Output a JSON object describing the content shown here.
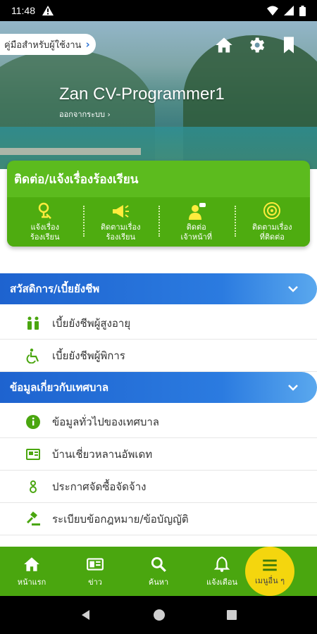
{
  "status_bar": {
    "time": "11:48",
    "warning_icon": "warning-icon",
    "wifi_icon": "wifi-icon",
    "signal_icon": "signal-icon",
    "battery_icon": "battery-icon"
  },
  "header": {
    "guide_label": "คู่มือสำหรับผู้ใช้งาน",
    "home_icon": "home-icon",
    "settings_icon": "gear-icon",
    "bookmark_icon": "bookmark-icon",
    "user_name": "Zan CV-Programmer1",
    "logout_label": "ออกจากระบบ"
  },
  "contact": {
    "title": "ติดต่อ/แจ้งเรื่องร้องเรียน",
    "items": [
      {
        "line1": "แจ้งเรื่อง",
        "line2": "ร้องเรียน",
        "icon": "complaint-icon"
      },
      {
        "line1": "ติดตามเรื่อง",
        "line2": "ร้องเรียน",
        "icon": "megaphone-icon"
      },
      {
        "line1": "ติดต่อ",
        "line2": "เจ้าหน้าที่",
        "icon": "staff-icon"
      },
      {
        "line1": "ติดตามเรื่อง",
        "line2": "ที่ติดต่อ",
        "icon": "target-icon"
      }
    ]
  },
  "sections": [
    {
      "title": "สวัสดิการ/เบี้ยยังชีพ",
      "items": [
        {
          "label": "เบี้ยยังชีพผู้สูงอายุ",
          "icon": "elderly-icon"
        },
        {
          "label": "เบี้ยยังชีพผู้พิการ",
          "icon": "wheelchair-icon"
        }
      ]
    },
    {
      "title": "ข้อมูลเกี่ยวกับเทศบาล",
      "items": [
        {
          "label": "ข้อมูลทั่วไปของเทศบาล",
          "icon": "info-icon"
        },
        {
          "label": "บ้านเชี่ยวหลานอัพเดท",
          "icon": "news-icon"
        },
        {
          "label": "ประกาศจัดซื้อจัดจ้าง",
          "icon": "procurement-icon"
        },
        {
          "label": "ระเบียบข้อกฎหมาย/ข้อบัญญัติ",
          "icon": "gavel-icon"
        }
      ]
    }
  ],
  "bottom_nav": [
    {
      "label": "หน้าแรก",
      "icon": "home-icon"
    },
    {
      "label": "ข่าว",
      "icon": "news-icon"
    },
    {
      "label": "ค้นหา",
      "icon": "search-icon"
    },
    {
      "label": "แจ้งเตือน",
      "icon": "bell-icon"
    },
    {
      "label": "เมนูอื่น ๆ",
      "icon": "menu-icon"
    }
  ],
  "colors": {
    "green": "#4aa60f",
    "blue": "#1e63cf",
    "yellow": "#f4d60e"
  }
}
